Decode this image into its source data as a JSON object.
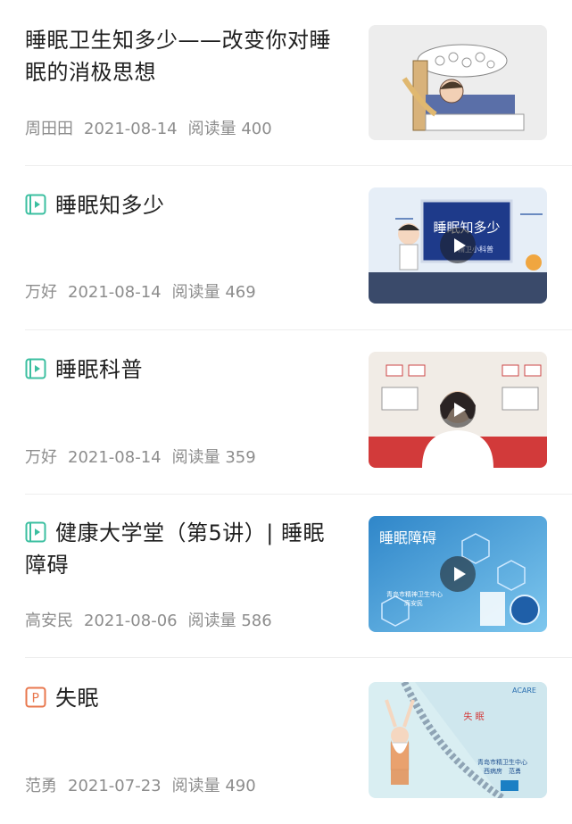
{
  "articles": [
    {
      "type": "article",
      "title": "睡眠卫生知多少——改变你对睡眠的消极思想",
      "author": "周田田",
      "date": "2021-08-14",
      "views_label": "阅读量 400"
    },
    {
      "type": "video",
      "title": "睡眠知多少",
      "author": "万好",
      "date": "2021-08-14",
      "views_label": "阅读量 469",
      "thumb_text": "睡眠知多少",
      "thumb_subtext": "精卫小科普"
    },
    {
      "type": "video",
      "title": "睡眠科普",
      "author": "万好",
      "date": "2021-08-14",
      "views_label": "阅读量 359"
    },
    {
      "type": "video",
      "title": "健康大学堂（第5讲）| 睡眠障碍",
      "author": "高安民",
      "date": "2021-08-06",
      "views_label": "阅读量 586",
      "thumb_text": "睡眠障碍",
      "thumb_subtext": "青岛市精神卫生中心",
      "thumb_subtext2": "高安民"
    },
    {
      "type": "ppt",
      "title": "失眠",
      "author": "范勇",
      "date": "2021-07-23",
      "views_label": "阅读量 490",
      "thumb_text": "失 眠",
      "thumb_subtext": "青岛市精卫生中心",
      "thumb_subtext2": "西病房　范勇",
      "thumb_logo": "ACARE"
    }
  ],
  "colors": {
    "video_icon": "#3bbfa0",
    "ppt_icon": "#e8774d",
    "meta_text": "#8d8d8d",
    "title_text": "#1f1f1f"
  },
  "icons": {
    "video": "video-play-square-icon",
    "ppt": "p-square-icon"
  }
}
